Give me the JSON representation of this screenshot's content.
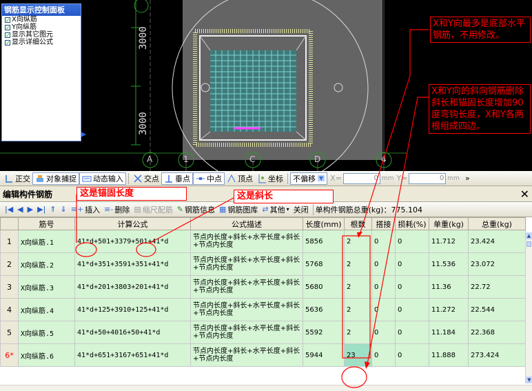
{
  "panel": {
    "title": "钢筋显示控制面板",
    "items": [
      {
        "label": "X向纵筋",
        "checked": true
      },
      {
        "label": "Y向纵筋",
        "checked": true
      },
      {
        "label": "显示其它图元",
        "checked": true
      },
      {
        "label": "显示详细公式",
        "checked": true
      }
    ]
  },
  "cad": {
    "dim_top": "3000",
    "dim_bottom": "3000",
    "axis_labels": [
      "A",
      "1",
      "C",
      "D",
      "4"
    ]
  },
  "notes": {
    "note1": "X和Y向最多是底部水平钢筋，不用修改。",
    "note2": "X和Y向的斜向钢筋删除斜长和锚固长度增加90度弯钩长度，X和Y各两根组成四边。",
    "anchor_label": "这是锚固长度",
    "slope_label": "这是斜长"
  },
  "snapbar": {
    "ortho": "正交",
    "object_snap": "对象捕捉",
    "dynamic_input": "动态输入",
    "intersection": "交点",
    "perpendicular": "垂点",
    "midpoint": "中点",
    "vertex": "顶点",
    "coordinate": "坐标",
    "offset": "不偏移",
    "x_label": "X=",
    "x_value": "0",
    "unit_mm1": "mm",
    "y_label": "Y=",
    "y_value": "0",
    "unit_mm2": "mm",
    "more": "»"
  },
  "edit": {
    "title": "编辑构件钢筋",
    "insert": "插入",
    "delete": "删除",
    "ruler_rebar": "缩尺配筋",
    "rebar_info": "钢筋信息",
    "rebar_library": "钢筋图库",
    "other": "其他",
    "close": "关闭",
    "total_weight": "单构件钢筋总重(kg)：775.104"
  },
  "table": {
    "headers": [
      "",
      "筋号",
      "计算公式",
      "公式描述",
      "长度(mm)",
      "根数",
      "搭接",
      "损耗(%)",
      "单重(kg)",
      "总重(kg)"
    ],
    "rows": [
      {
        "num": "1",
        "name": "X向纵筋.1",
        "formula": "41*d+501+3379+501+41*d",
        "desc": "节点内长度+斜长+水平长度+斜长+节点内长度",
        "length": "5856",
        "count": "2",
        "lap": "0",
        "loss": "0",
        "unit_wt": "11.712",
        "total_wt": "23.424"
      },
      {
        "num": "2",
        "name": "X向纵筋.2",
        "formula": "41*d+351+3591+351+41*d",
        "desc": "节点内长度+斜长+水平长度+斜长+节点内长度",
        "length": "5768",
        "count": "2",
        "lap": "0",
        "loss": "0",
        "unit_wt": "11.536",
        "total_wt": "23.072"
      },
      {
        "num": "3",
        "name": "X向纵筋.3",
        "formula": "41*d+201+3803+201+41*d",
        "desc": "节点内长度+斜长+水平长度+斜长+节点内长度",
        "length": "5680",
        "count": "2",
        "lap": "0",
        "loss": "0",
        "unit_wt": "11.36",
        "total_wt": "22.72"
      },
      {
        "num": "4",
        "name": "X向纵筋.4",
        "formula": "41*d+125+3910+125+41*d",
        "desc": "节点内长度+斜长+水平长度+斜长+节点内长度",
        "length": "5636",
        "count": "2",
        "lap": "0",
        "loss": "0",
        "unit_wt": "11.272",
        "total_wt": "22.544"
      },
      {
        "num": "5",
        "name": "X向纵筋.5",
        "formula": "41*d+50+4016+50+41*d",
        "desc": "节点内长度+斜长+水平长度+斜长+节点内长度",
        "length": "5592",
        "count": "2",
        "lap": "0",
        "loss": "0",
        "unit_wt": "11.184",
        "total_wt": "22.368"
      },
      {
        "num": "6*",
        "name": "X向纵筋.6",
        "formula": "41*d+651+3167+651+41*d",
        "desc": "节点内长度+斜长+水平长度+斜长+节点内长度",
        "length": "5944",
        "count": "23",
        "lap": "0",
        "loss": "0",
        "unit_wt": "11.888",
        "total_wt": "273.424"
      }
    ]
  }
}
